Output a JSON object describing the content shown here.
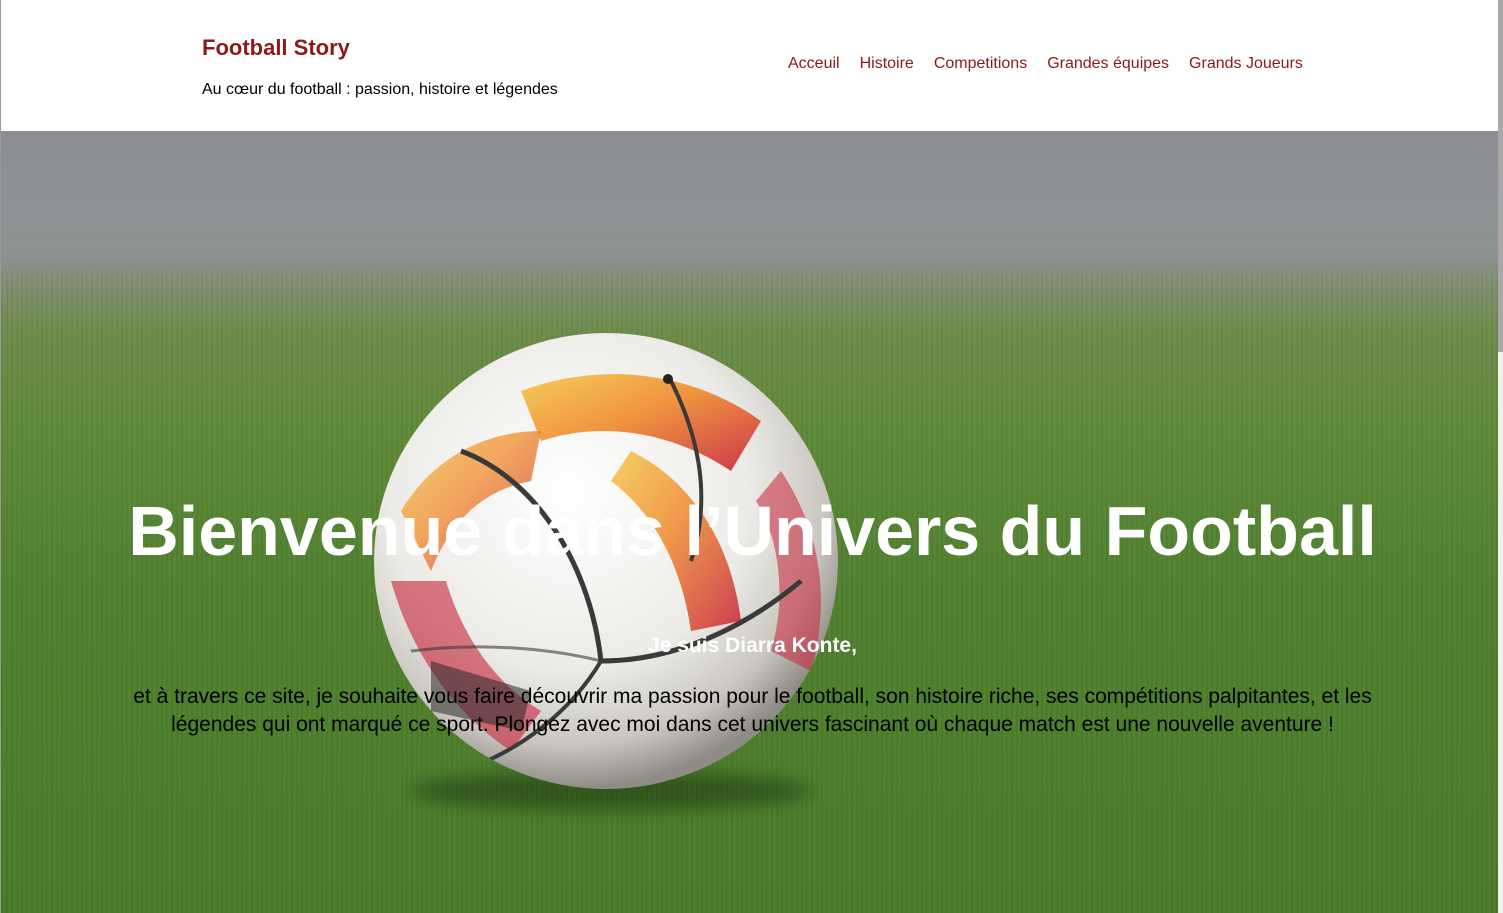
{
  "header": {
    "title": "Football Story",
    "tagline": "Au cœur du football : passion, histoire et légendes"
  },
  "nav": {
    "items": [
      {
        "label": "Acceuil"
      },
      {
        "label": "Histoire"
      },
      {
        "label": "Competitions"
      },
      {
        "label": "Grandes équipes"
      },
      {
        "label": "Grands Joueurs"
      }
    ]
  },
  "hero": {
    "image": "soccer-ball-on-grass",
    "heading": "Bienvenue dans l’Univers du Football",
    "intro": "Je suis Diarra Konte,",
    "text": "et à travers ce site, je souhaite vous faire découvrir ma passion pour le football, son histoire riche, ses compétitions palpitantes, et les légendes qui ont marqué ce sport. Plongez avec moi dans cet univers fascinant où chaque match est une nouvelle aventure !"
  },
  "colors": {
    "brand": "#8b1a1a",
    "header_bg": "#ffffff",
    "hero_text": "#ffffff"
  }
}
